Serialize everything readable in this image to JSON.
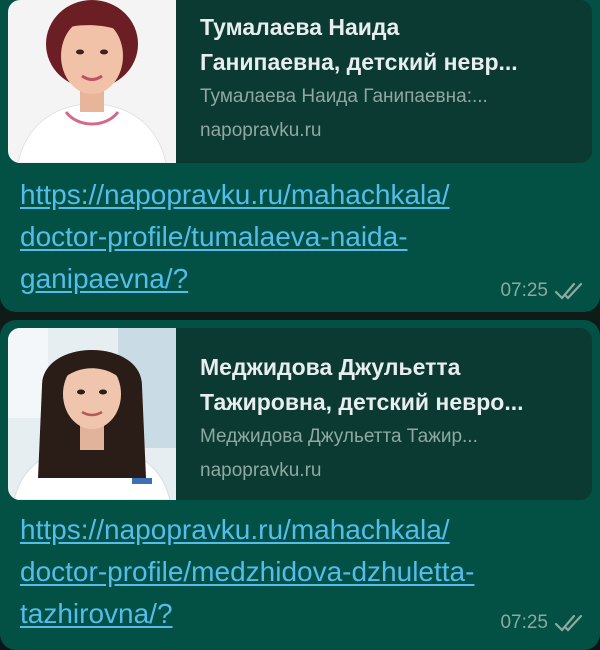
{
  "messages": [
    {
      "preview": {
        "title_line1": "Тумалаева Наида",
        "title_line2": "Ганипаевна, детский невр...",
        "description": "Тумалаева Наида Ганипаевна:...",
        "domain": "napopravku.ru",
        "thumbnail_icon": "doctor-portrait-photo"
      },
      "link": {
        "line1": "https://napopravku.ru/mahachkala/",
        "line2": "doctor-profile/tumalaeva-naida-",
        "line3": "ganipaevna/?"
      },
      "time": "07:25",
      "status_icon": "double-check-icon"
    },
    {
      "preview": {
        "title_line1": "Меджидова Джульетта",
        "title_line2": "Тажировна, детский невро...",
        "description": "Меджидова Джульетта Тажир...",
        "domain": "napopravku.ru",
        "thumbnail_icon": "doctor-portrait-photo"
      },
      "link": {
        "line1": "https://napopravku.ru/mahachkala/",
        "line2": "doctor-profile/medzhidova-dzhuletta-",
        "line3": "tazhirovna/?"
      },
      "time": "07:25",
      "status_icon": "double-check-icon"
    }
  ],
  "colors": {
    "bubble": "#025144",
    "preview_bg": "#0a3a32",
    "link": "#53bdeb",
    "title": "#e9edef",
    "muted": "#8fa8a2"
  }
}
